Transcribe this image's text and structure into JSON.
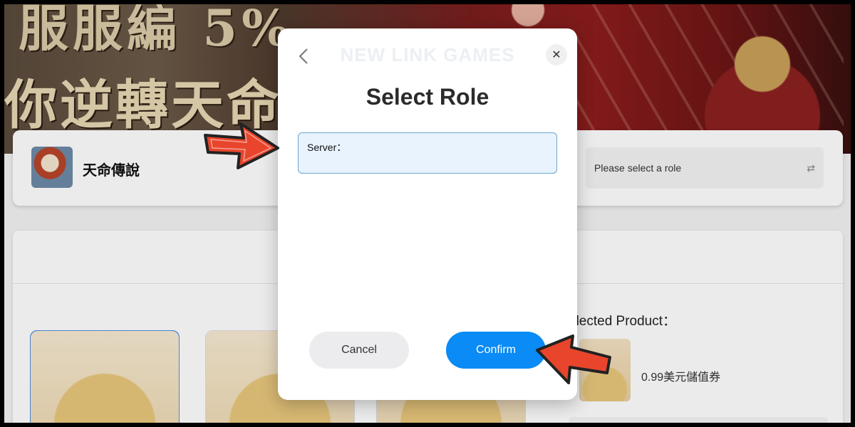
{
  "banner": {
    "line1": "服服編 5%",
    "line2": "你逆轉天命"
  },
  "game": {
    "title": "天命傳說",
    "role_placeholder": "Please select a role",
    "swap_icon": "⇄"
  },
  "product": {
    "selected_label": "elected Product：",
    "selected_name": "0.99美元儲值券"
  },
  "modal": {
    "brand": "NEW LINK GAMES",
    "title": "Select Role",
    "server_label": "Server：",
    "cancel_label": "Cancel",
    "confirm_label": "Confirm",
    "close_icon": "✕",
    "back_icon": "chevron-left-icon"
  },
  "colors": {
    "accent": "#0a8bf5",
    "server_field_bg": "#e8f3fd",
    "arrow_red": "#e8452c"
  }
}
